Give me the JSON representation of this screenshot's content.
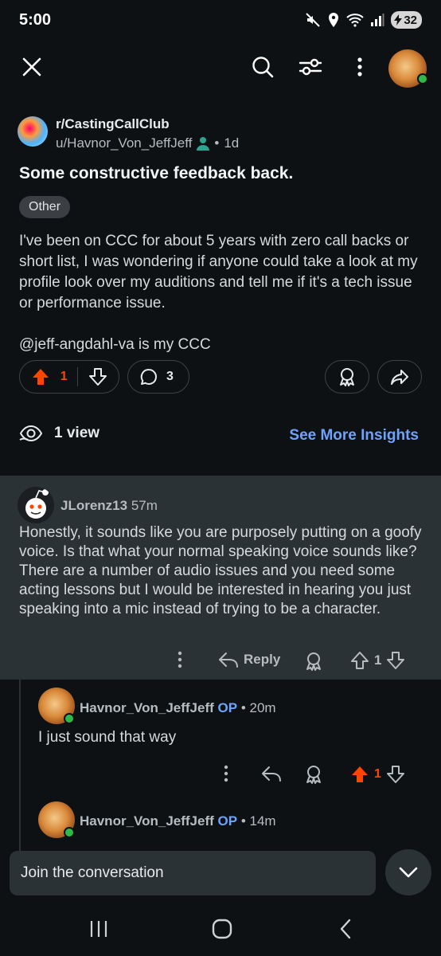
{
  "status": {
    "time": "5:00",
    "battery": "32"
  },
  "post": {
    "subreddit": "r/CastingCallClub",
    "author": "u/Havnor_Von_JeffJeff",
    "age": "1d",
    "title": "Some constructive feedback back.",
    "flair": "Other",
    "body_p1": "I've been on CCC for about 5 years with zero call backs or short list, I was wondering if anyone could take a look at my profile look over my auditions and tell me if it's a tech issue or performance issue.",
    "body_p2": "@jeff-angdahl-va is my CCC",
    "upvotes": "1",
    "comments": "3",
    "views": "1 view",
    "insights_label": "See More Insights"
  },
  "comments": [
    {
      "user": "JLorenz13",
      "time": "57m",
      "body": "Honestly, it sounds like you are purposely putting on a goofy voice. Is that what your normal speaking voice sounds like? There are a number of audio issues and you need some acting lessons but I would be interested in hearing you just speaking into a mic instead of trying to be a character.",
      "reply_label": "Reply",
      "votes": "1"
    }
  ],
  "replies": [
    {
      "user": "Havnor_Von_JeffJeff",
      "op": "OP",
      "time": "20m",
      "body": "I just sound that way",
      "votes": "1"
    },
    {
      "user": "Havnor_Von_JeffJeff",
      "op": "OP",
      "time": "14m"
    }
  ],
  "composer": {
    "placeholder": "Join the conversation"
  },
  "colors": {
    "accent_orange": "#ff4500",
    "link_blue": "#6da3ff",
    "online_green": "#2fb94b",
    "background": "#0e1113"
  }
}
